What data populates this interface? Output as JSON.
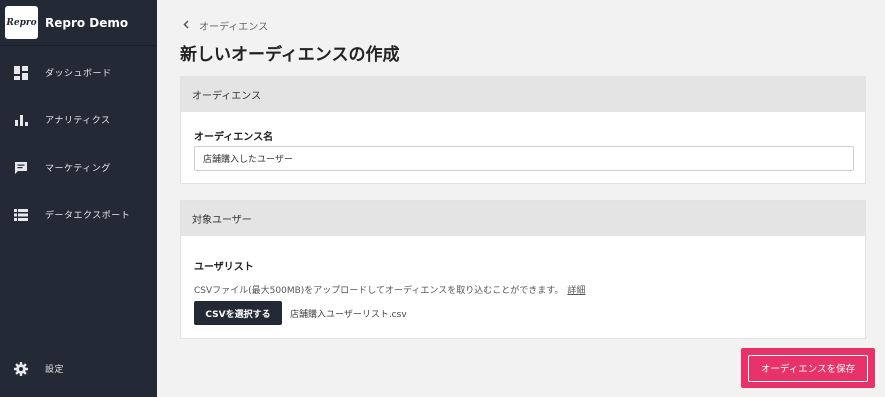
{
  "brand": {
    "logo_text": "Repro",
    "name": "Repro Demo"
  },
  "sidebar": {
    "items": [
      {
        "label": "ダッシュボード",
        "icon": "dashboard-icon"
      },
      {
        "label": "アナリティクス",
        "icon": "bar-chart-icon"
      },
      {
        "label": "マーケティング",
        "icon": "message-icon"
      },
      {
        "label": "データエクスポート",
        "icon": "list-icon"
      }
    ],
    "settings": {
      "label": "設定",
      "icon": "gear-icon"
    }
  },
  "breadcrumb": {
    "label": "オーディエンス"
  },
  "page": {
    "title": "新しいオーディエンスの作成"
  },
  "audience_card": {
    "header": "オーディエンス",
    "name_label": "オーディエンス名",
    "name_value": "店舗購入したユーザー"
  },
  "users_card": {
    "header": "対象ユーザー",
    "list_label": "ユーザリスト",
    "help_text": "CSVファイル(最大500MB)をアップロードしてオーディエンスを取り込むことができます。",
    "help_link": "詳細",
    "select_button": "CSVを選択する",
    "file_name": "店舗購入ユーザーリスト.csv"
  },
  "actions": {
    "save_label": "オーディエンスを保存"
  },
  "colors": {
    "sidebar_bg": "#242a35",
    "accent": "#e8336a",
    "page_bg": "#f2f2f2"
  }
}
